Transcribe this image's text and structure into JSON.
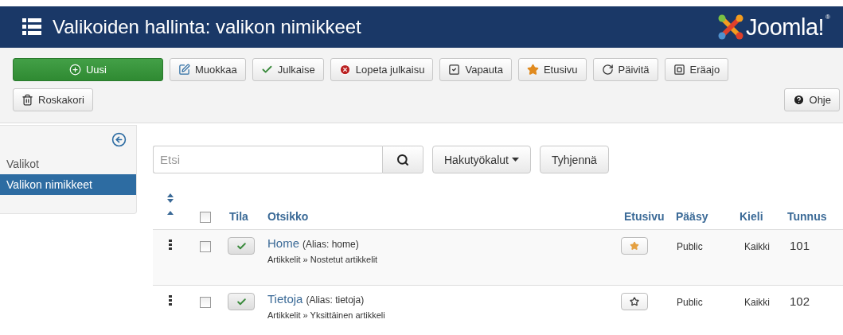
{
  "header": {
    "title": "Valikoiden hallinta: valikon nimikkeet",
    "logo_text": "Joomla!",
    "logo_mark": "®"
  },
  "toolbar": [
    {
      "label": "Uusi",
      "kind": "new"
    },
    {
      "label": "Muokkaa",
      "kind": "edit"
    },
    {
      "label": "Julkaise",
      "kind": "publish"
    },
    {
      "label": "Lopeta julkaisu",
      "kind": "unpublish"
    },
    {
      "label": "Vapauta",
      "kind": "checkin"
    },
    {
      "label": "Etusivu",
      "kind": "featured"
    },
    {
      "label": "Päivitä",
      "kind": "rebuild"
    },
    {
      "label": "Eräajo",
      "kind": "batch"
    },
    {
      "label": "Roskakori",
      "kind": "trash"
    },
    {
      "label": "Ohje",
      "kind": "help"
    }
  ],
  "sidebar": {
    "items": [
      {
        "label": "Valikot",
        "selected": false
      },
      {
        "label": "Valikon nimikkeet",
        "selected": true
      }
    ]
  },
  "search": {
    "placeholder": "Etsi"
  },
  "filters": [
    {
      "label": "Hakutyökalut",
      "kind": "dropdown"
    },
    {
      "label": "Tyhjennä",
      "kind": "plain"
    }
  ],
  "table": {
    "columns": [
      "Tila",
      "Otsikko",
      "Etusivu",
      "Pääsy",
      "Kieli",
      "Tunnus"
    ],
    "select_all": {
      "checked": false
    },
    "rows": [
      {
        "checked": false,
        "published": true,
        "title": "Home",
        "alias": "(Alias: home)",
        "path": "Artikkelit » Nostetut artikkelit",
        "featured": true,
        "access": "Public",
        "language": "Kaikki",
        "id": "101"
      },
      {
        "checked": false,
        "published": true,
        "title": "Tietoja",
        "alias": "(Alias: tietoja)",
        "path": "Artikkelit » Yksittäinen artikkeli",
        "featured": false,
        "access": "Public",
        "language": "Kaikki",
        "id": "102"
      }
    ]
  }
}
